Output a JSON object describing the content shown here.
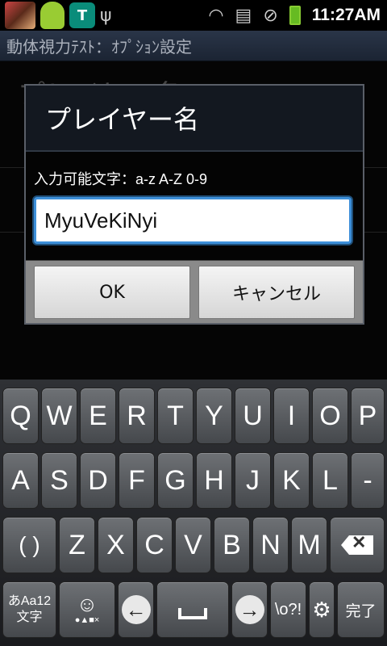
{
  "status_bar": {
    "time": "11:27AM",
    "icons": [
      "game-app-icon",
      "android-icon",
      "shield-app-icon",
      "usb-icon",
      "wifi-icon",
      "sd-card-icon",
      "no-sound-icon",
      "battery-charging-icon"
    ]
  },
  "title_bar": {
    "title": "動体視力ﾃｽﾄ：ｵﾌﾟｼｮﾝ設定"
  },
  "background": {
    "row1_text": "プレイヤー名"
  },
  "dialog": {
    "title": "プレイヤー名",
    "label": "入力可能文字：a-z A-Z 0-9",
    "input_value": "MyuVeKiNyi",
    "ok_label": "OK",
    "cancel_label": "キャンセル"
  },
  "keyboard": {
    "row1": [
      "Q",
      "W",
      "E",
      "R",
      "T",
      "Y",
      "U",
      "I",
      "O",
      "P"
    ],
    "row2": [
      "A",
      "S",
      "D",
      "F",
      "G",
      "H",
      "J",
      "K",
      "L",
      "-"
    ],
    "row3": [
      "( )",
      "Z",
      "X",
      "C",
      "V",
      "B",
      "N",
      "M"
    ],
    "mode_key": {
      "top": "あAa12",
      "bottom": "文字"
    },
    "emoji_key_symbols": "●▲■×",
    "symbol_key": "\\o?!",
    "done_label": "完了",
    "backspace_glyph": "✕"
  },
  "colors": {
    "input_border": "#3d8fd9",
    "titlebar": "#2a3548"
  }
}
